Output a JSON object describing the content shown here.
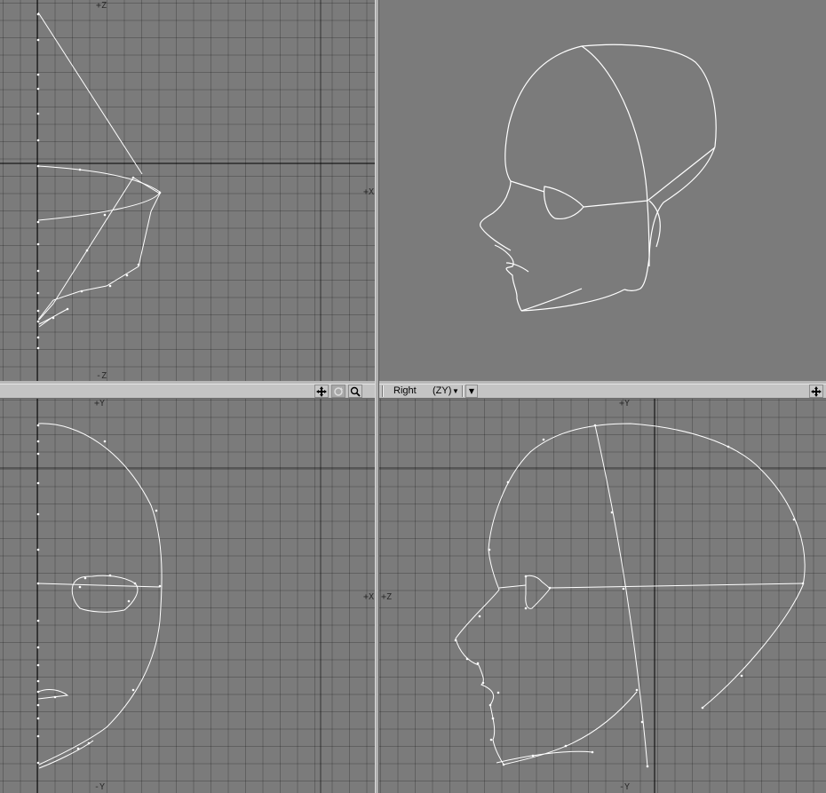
{
  "viewports": {
    "top": {
      "axis_top": "+Z",
      "axis_right": "+X",
      "axis_bottom": "-Z"
    },
    "front": {
      "axis_top": "+Y",
      "axis_right": "+X",
      "axis_bottom": "-Y"
    },
    "right": {
      "view_name": "Right",
      "view_axes": "(ZY)",
      "axis_top": "+Y",
      "axis_left": "+Z",
      "axis_bottom": "-Y"
    }
  },
  "toolbar_icons": {
    "move": "move-arrows-icon",
    "rotate": "rotate-icon",
    "zoom": "magnifier-icon",
    "dropdown": "chevron-down-icon"
  },
  "colors": {
    "viewport_bg": "#7b7b7b",
    "grid": "#626262",
    "axis_line": "#000000",
    "wire": "#ffffff",
    "toolbar_bg": "#c4c4c4"
  }
}
